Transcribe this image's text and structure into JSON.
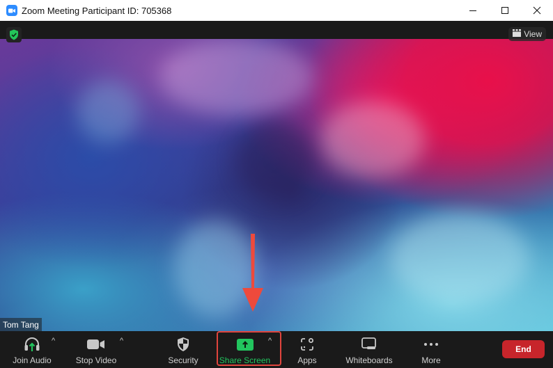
{
  "window": {
    "title": "Zoom Meeting Participant ID: 705368",
    "controls": {
      "minimize": "minimize-icon",
      "maximize": "maximize-icon",
      "close": "close-icon"
    }
  },
  "meeting": {
    "encryption_icon": "shield-check-icon",
    "view_label": "View",
    "participant_name": "Tom Tang",
    "annotation": "red-down-arrow"
  },
  "toolbar": {
    "items": [
      {
        "label": "Join Audio",
        "icon": "headphones-icon",
        "has_caret": true
      },
      {
        "label": "Stop Video",
        "icon": "video-camera-icon",
        "has_caret": true
      },
      {
        "label": "Security",
        "icon": "security-shield-icon",
        "has_caret": false
      },
      {
        "label": "Share Screen",
        "icon": "share-screen-icon",
        "has_caret": true,
        "highlighted": true
      },
      {
        "label": "Apps",
        "icon": "apps-icon",
        "has_caret": false
      },
      {
        "label": "Whiteboards",
        "icon": "whiteboard-icon",
        "has_caret": false
      },
      {
        "label": "More",
        "icon": "more-dots-icon",
        "has_caret": false
      }
    ],
    "end_label": "End"
  },
  "colors": {
    "share_green": "#22c55e",
    "end_red": "#c7252b",
    "highlight_red": "#e0443d",
    "zoom_blue": "#2d8cff"
  }
}
